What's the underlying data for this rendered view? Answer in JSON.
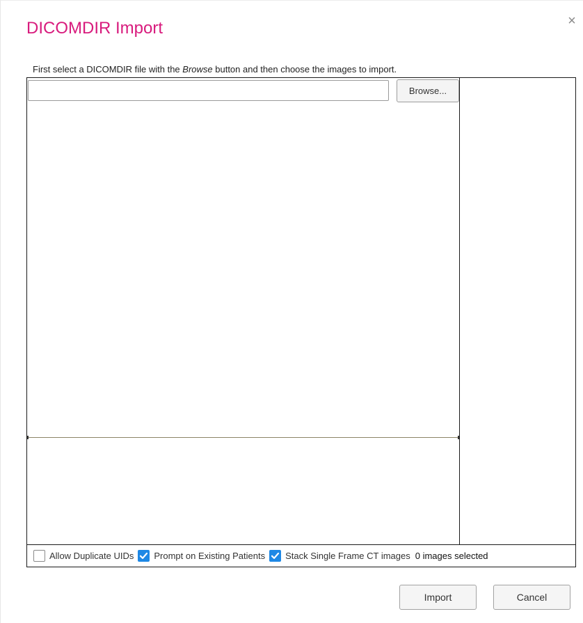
{
  "dialog": {
    "title": "DICOMDIR Import",
    "close_glyph": "×",
    "instructions": {
      "before": "First select a DICOMDIR file with the ",
      "emphasis": "Browse",
      "after": " button and then choose the images to import."
    },
    "file_input": {
      "value": "",
      "placeholder": ""
    },
    "browse_label": "Browse...",
    "options": {
      "allow_duplicate_uids": {
        "label": "Allow Duplicate UIDs",
        "checked": false
      },
      "prompt_existing_patients": {
        "label": "Prompt on Existing Patients",
        "checked": true
      },
      "stack_single_frame_ct": {
        "label": "Stack Single Frame CT images",
        "checked": true
      }
    },
    "selection_count": "0 images selected",
    "import_label": "Import",
    "cancel_label": "Cancel"
  },
  "colors": {
    "title": "#d81b7d",
    "checkbox_on": "#1e88e5"
  },
  "icons": {
    "close": "close-icon",
    "check": "check-icon"
  }
}
